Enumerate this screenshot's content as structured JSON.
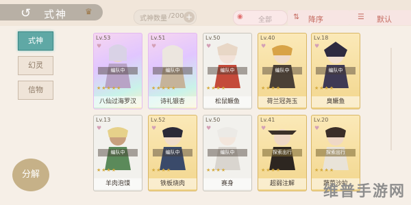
{
  "header": {
    "back_icon": "back-arrow-icon",
    "title": "式神",
    "counter_label": "式神数量",
    "counter_value": "/200",
    "filter_text": "全部",
    "sort_label": "降序",
    "default_label": "默认"
  },
  "menu": {
    "items": [
      {
        "label": "式神",
        "active": true
      },
      {
        "label": "幻灵",
        "active": false
      },
      {
        "label": "信物",
        "active": false
      }
    ],
    "decompose_label": "分解"
  },
  "cards": [
    {
      "level": "Lv.53",
      "status": "编队中",
      "name": "八仙过海罗汉",
      "rarity": "rare"
    },
    {
      "level": "Lv.51",
      "status": "编队中",
      "name": "诗礼银杏",
      "rarity": "rare"
    },
    {
      "level": "Lv.50",
      "status": "编队中",
      "name": "松鼠鳜鱼",
      "rarity": "silver"
    },
    {
      "level": "Lv.40",
      "status": "编队中",
      "name": "荷兰冠尧玉",
      "rarity": "gold"
    },
    {
      "level": "Lv.18",
      "status": "编队中",
      "name": "臭鳜鱼",
      "rarity": "gold"
    },
    {
      "level": "Lv.13",
      "status": "编队中",
      "name": "羊肉泡馍",
      "rarity": "silver"
    },
    {
      "level": "Lv.52",
      "status": "编队中",
      "name": "铁板烧肉",
      "rarity": "gold"
    },
    {
      "level": "Lv.50",
      "status": "编队中",
      "name": "赛身",
      "rarity": "silver"
    },
    {
      "level": "Lv.41",
      "status": "探索出行",
      "name": "超弱注解",
      "rarity": "gold"
    },
    {
      "level": "Lv.20",
      "status": "探索出行",
      "name": "蔬菜沙拉",
      "rarity": "gold"
    }
  ],
  "watermark": "维普手游网",
  "colors": {
    "accent": "#5fa8a5",
    "sort_text": "#c56b60",
    "gold_border": "#d8b563"
  }
}
